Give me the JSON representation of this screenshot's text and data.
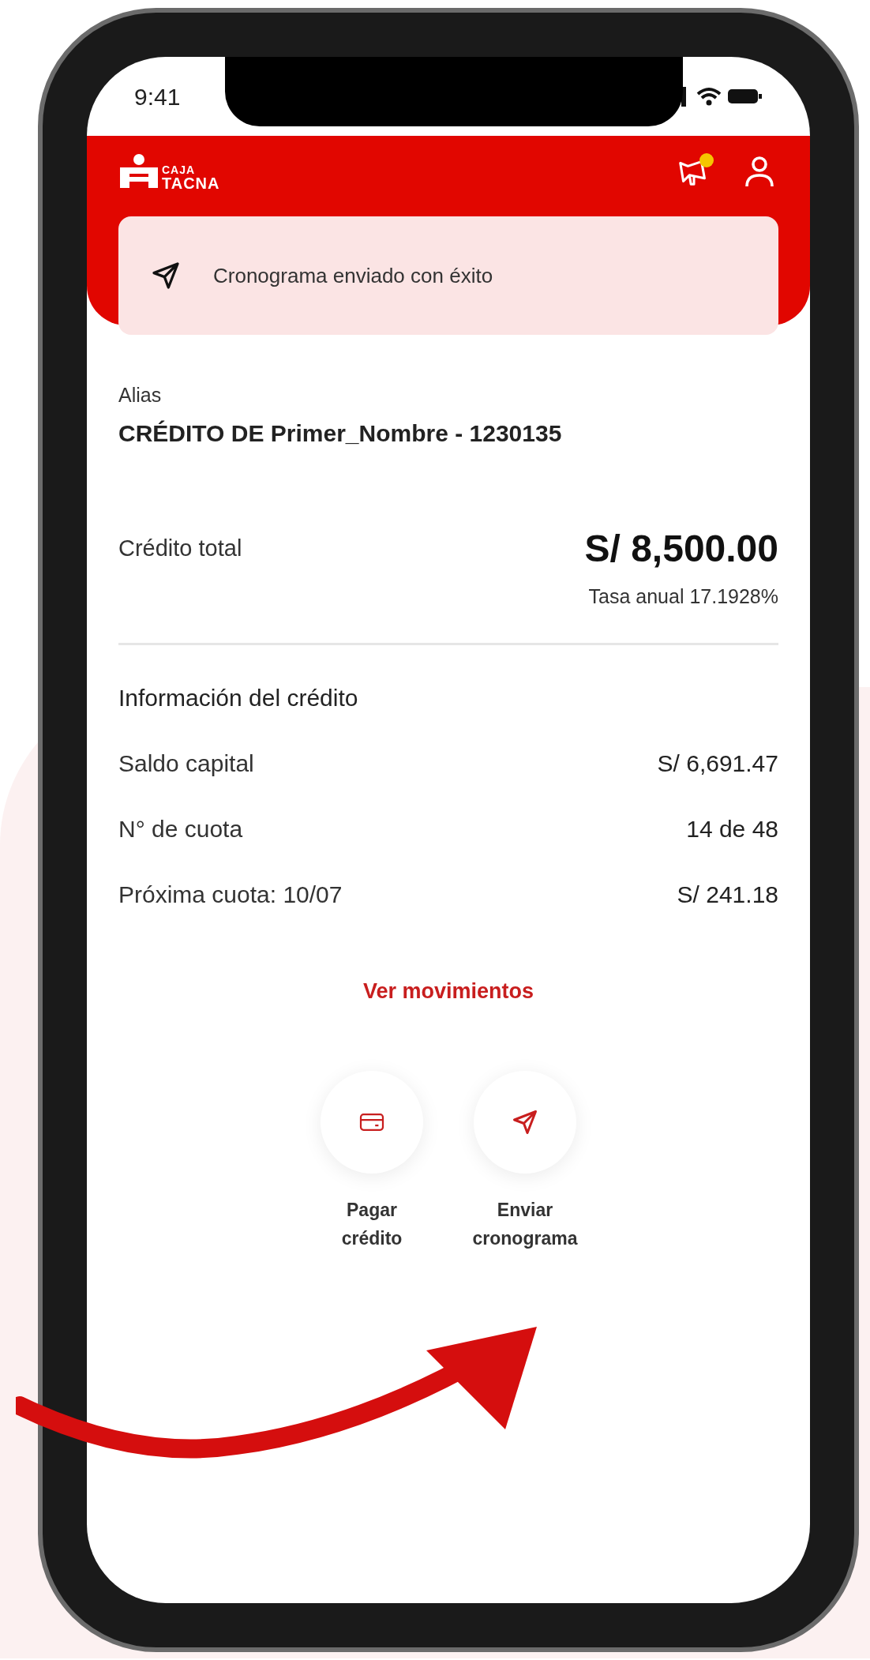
{
  "status_bar": {
    "time": "9:41"
  },
  "header": {
    "logo_lines": [
      "CAJA",
      "TACNA"
    ],
    "notification_dot": true
  },
  "toast": {
    "message": "Cronograma enviado con éxito"
  },
  "alias": {
    "label": "Alias",
    "value": "CRÉDITO DE Primer_Nombre - 1230135"
  },
  "credit_total": {
    "label": "Crédito total",
    "amount": "S/ 8,500.00",
    "rate": "Tasa anual 17.1928%"
  },
  "info": {
    "title": "Información del crédito",
    "rows": [
      {
        "label": "Saldo capital",
        "value": "S/ 6,691.47"
      },
      {
        "label": "N° de cuota",
        "value": "14 de 48"
      },
      {
        "label": "Próxima cuota: 10/07",
        "value": "S/ 241.18"
      }
    ]
  },
  "link": "Ver movimientos",
  "actions": [
    {
      "kind": "card",
      "label_lines": [
        "Pagar",
        "crédito"
      ]
    },
    {
      "kind": "send",
      "label_lines": [
        "Enviar",
        "cronograma"
      ]
    }
  ]
}
